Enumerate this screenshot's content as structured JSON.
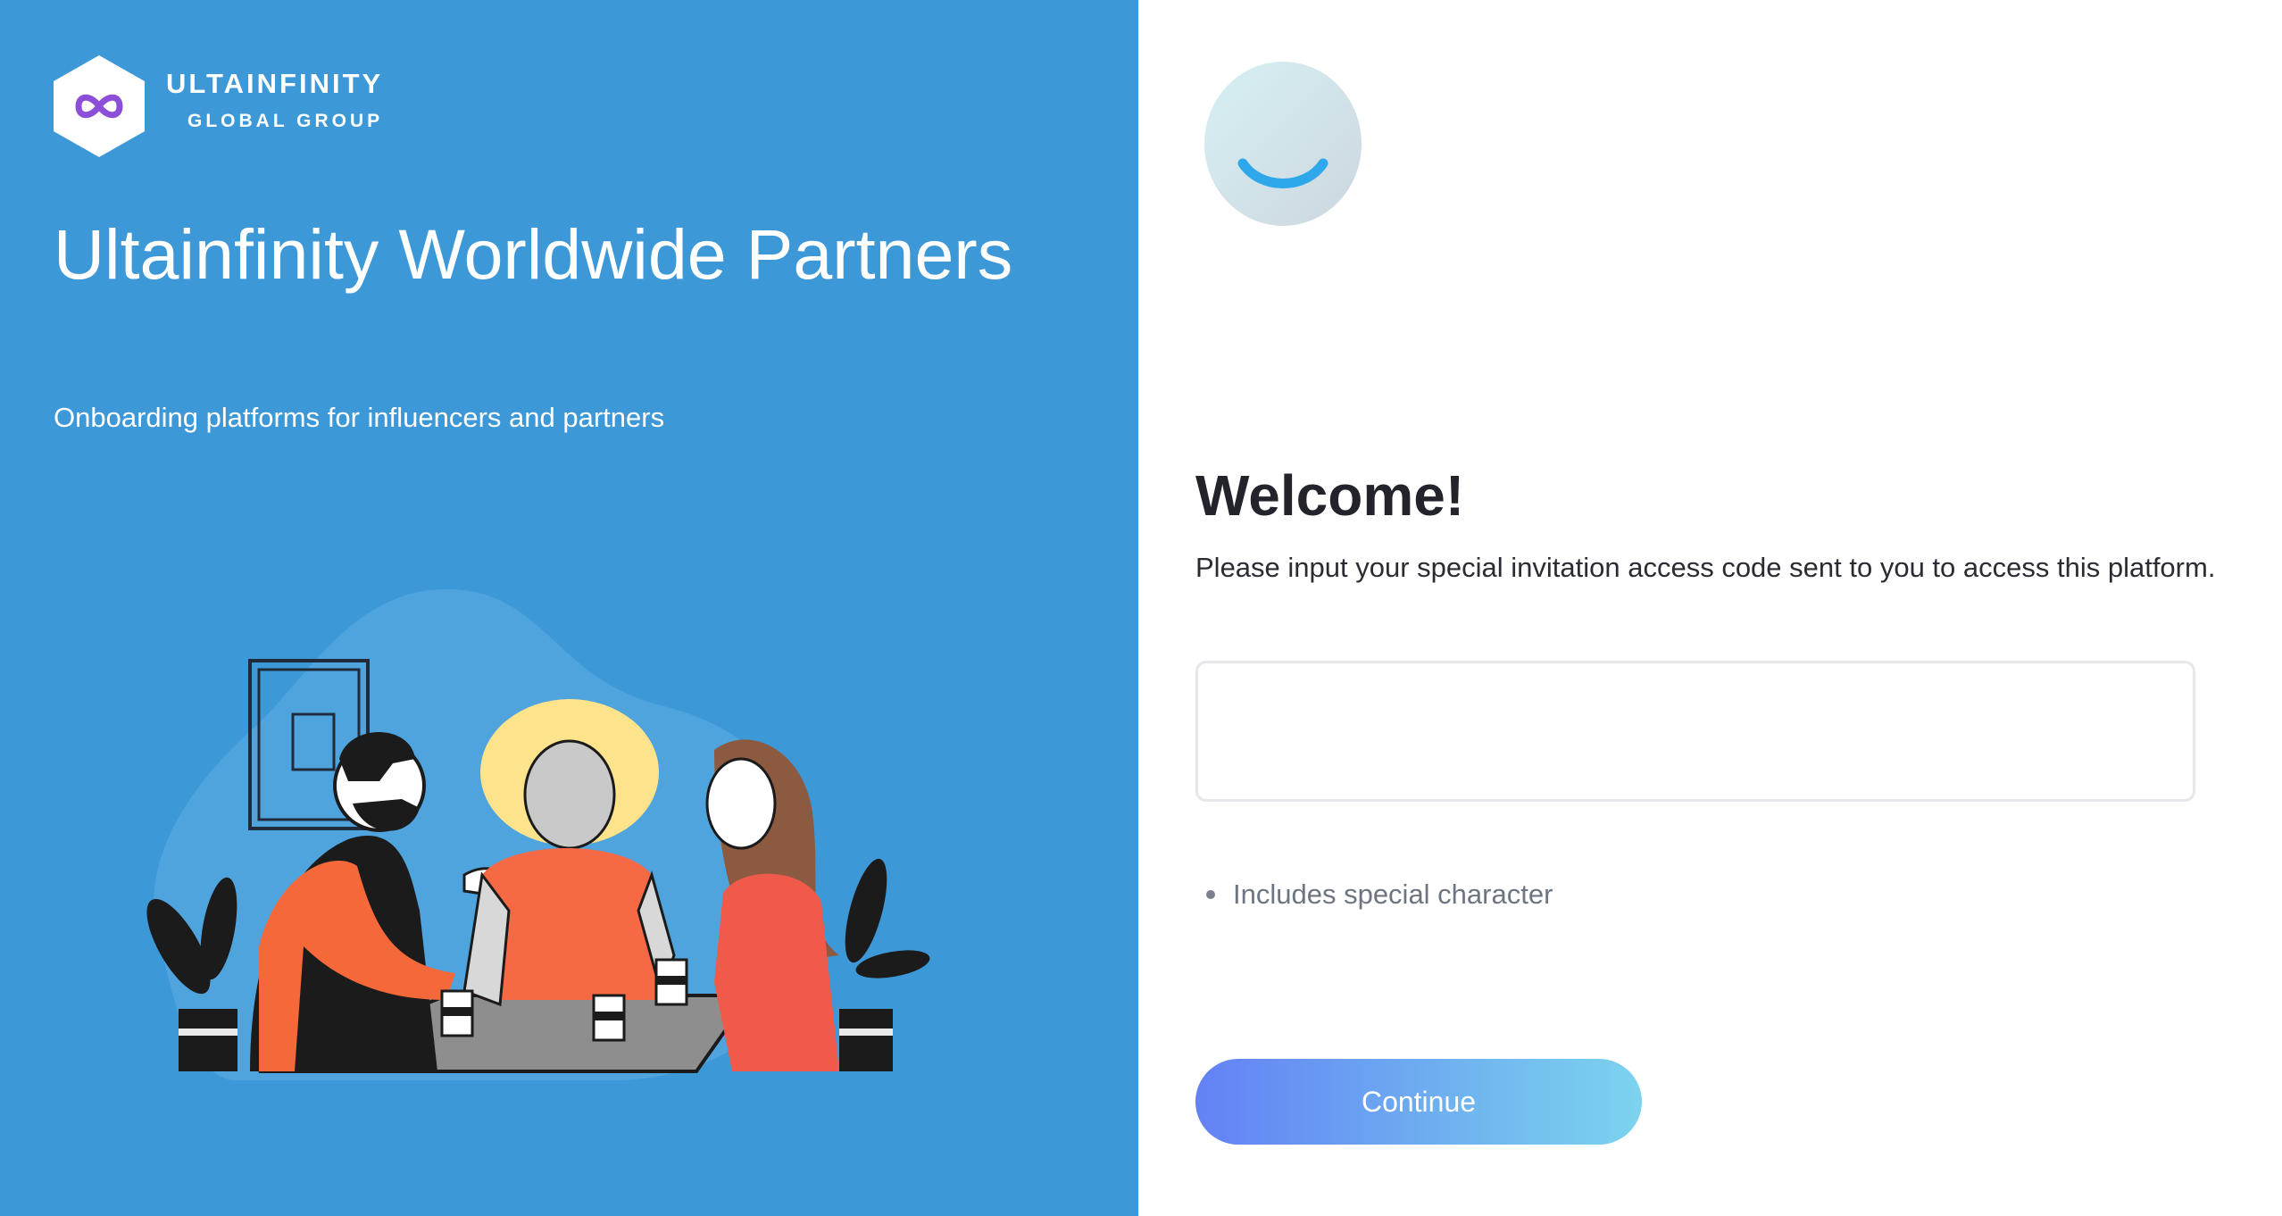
{
  "brand": {
    "name": "ULTAINFINITY",
    "subtitle": "GLOBAL GROUP",
    "logo_icon": "infinity-icon"
  },
  "hero": {
    "title": "Ultainfinity Worldwide Partners",
    "subtitle": "Onboarding platforms for influencers and partners",
    "illustration": "people-at-coffee-table-illustration"
  },
  "form": {
    "avatar_icon": "smile-avatar-icon",
    "heading": "Welcome!",
    "instructions": "Please input your special invitation access code sent to you to access this platform.",
    "code_input": {
      "value": "",
      "placeholder": ""
    },
    "rules": [
      {
        "label": "Includes special character"
      }
    ],
    "continue_label": "Continue"
  },
  "colors": {
    "left_panel_bg": "#3d98d8",
    "button_gradient_start": "#6381f5",
    "button_gradient_end": "#7dd3ef",
    "heading_text": "#23232b"
  }
}
